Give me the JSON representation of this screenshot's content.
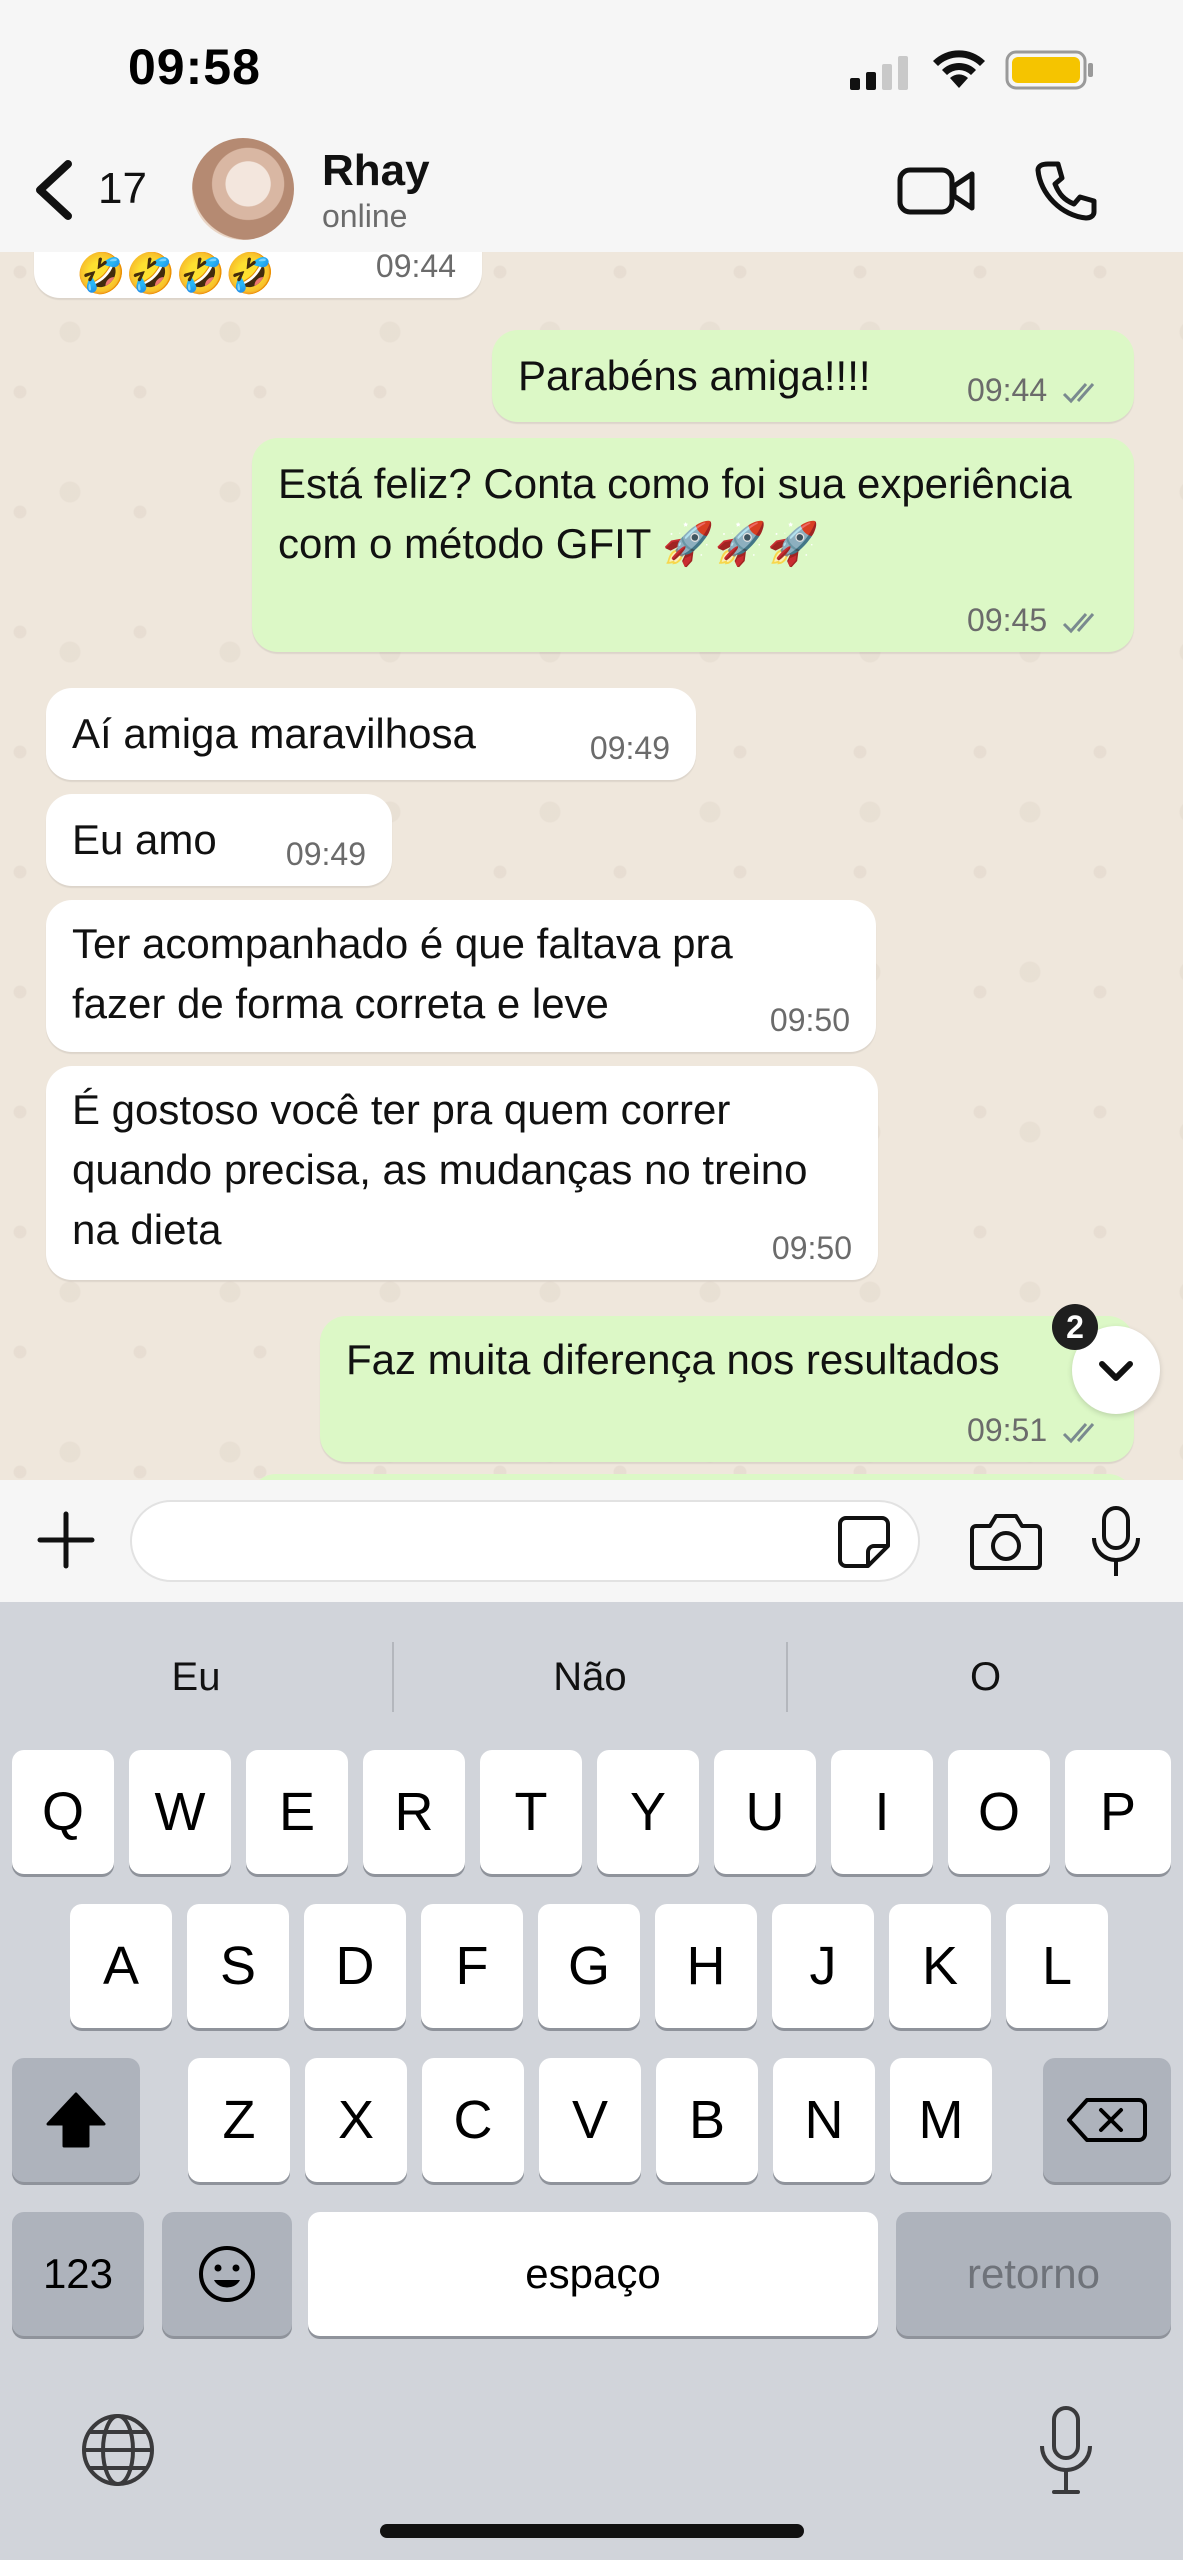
{
  "status_bar": {
    "time": "09:58"
  },
  "header": {
    "back_count": "17",
    "name": "Rhay",
    "status": "online"
  },
  "messages": [
    {
      "dir": "in",
      "text": "",
      "time": "09:44"
    },
    {
      "dir": "out",
      "text": "Parabéns amiga!!!!",
      "time": "09:44"
    },
    {
      "dir": "out",
      "text": "Está feliz? Conta como foi sua experiência com o método GFIT 🚀🚀🚀",
      "time": "09:45"
    },
    {
      "dir": "in",
      "text": "Aí amiga maravilhosa",
      "time": "09:49"
    },
    {
      "dir": "in",
      "text": "Eu amo",
      "time": "09:49"
    },
    {
      "dir": "in",
      "text": "Ter acompanhado é que faltava pra fazer de forma correta e leve",
      "time": "09:50"
    },
    {
      "dir": "in",
      "text": "É gostoso você ter pra quem correr quando precisa, as mudanças no treino na dieta",
      "time": "09:50"
    },
    {
      "dir": "out",
      "text": "Faz muita diferença nos resultados",
      "time": "09:51"
    }
  ],
  "scroll_badge": "2",
  "keyboard": {
    "suggestions": [
      "Eu",
      "Não",
      "O"
    ],
    "row1": [
      "Q",
      "W",
      "E",
      "R",
      "T",
      "Y",
      "U",
      "I",
      "O",
      "P"
    ],
    "row2": [
      "A",
      "S",
      "D",
      "F",
      "G",
      "H",
      "J",
      "K",
      "L"
    ],
    "row3": [
      "Z",
      "X",
      "C",
      "V",
      "B",
      "N",
      "M"
    ],
    "numbers_label": "123",
    "space_label": "espaço",
    "return_label": "retorno"
  }
}
